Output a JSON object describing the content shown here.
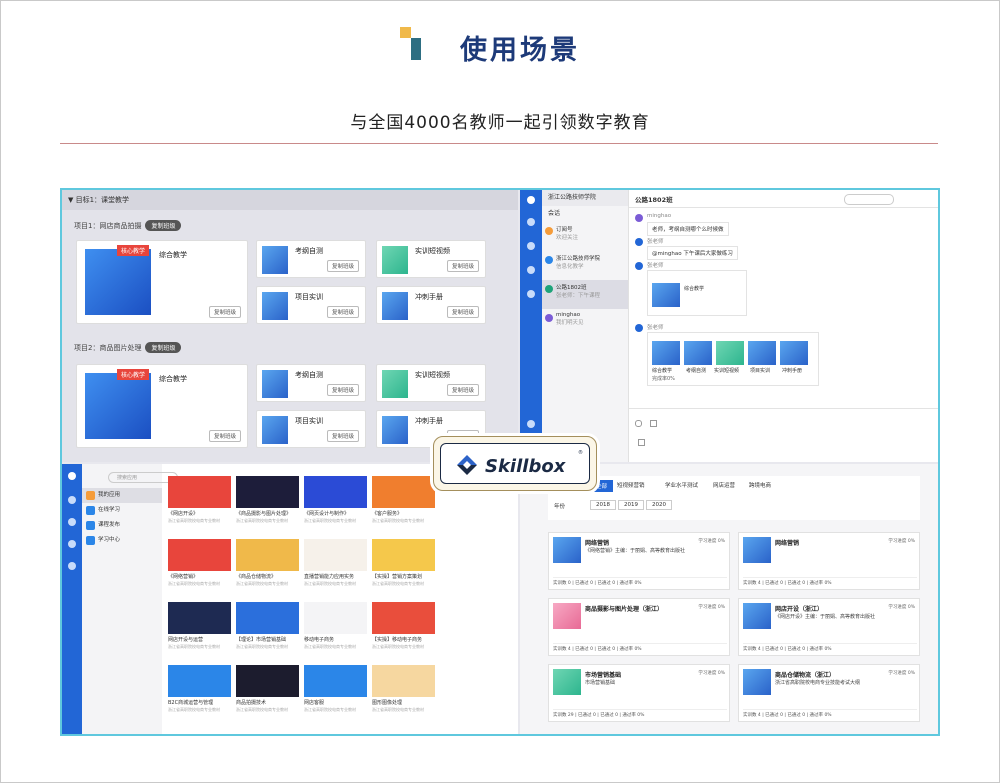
{
  "header": {
    "title": "使用场景",
    "subtitle": "与全国4000名教师一起引领数字教育"
  },
  "colors": {
    "brand_blue": "#2266d6",
    "title_navy": "#1d3a79",
    "frame_cyan": "#5fc8de",
    "accent_orange": "#f0b94a",
    "accent_teal": "#2d6e82"
  },
  "badge": {
    "label": "Skillbox",
    "reg": "®"
  },
  "q1": {
    "bar": "▼ 目标1：课堂教学",
    "project1": "项目1：网店商品拍摄",
    "project2": "项目2：商品图片处理",
    "copy_class": "复制班级",
    "ribbon": "核心教学",
    "cards": [
      "综合教学",
      "考纲自测",
      "实训短视频",
      "项目实训",
      "冲刺手册"
    ]
  },
  "q2": {
    "school": "浙江公路技师学院",
    "list_header": "会话",
    "list": [
      {
        "name": "订阅号",
        "preview": "欢迎关注"
      },
      {
        "name": "浙江公路技师学院",
        "preview": "信息化教学"
      },
      {
        "name": "公路1802班",
        "preview": "张老师：下午课程"
      },
      {
        "name": "minghao",
        "preview": "我们明天见"
      }
    ],
    "chat_title": "公路1802班",
    "m1_name": "minghao",
    "m1_text": "老师，考纲自测哪个么时候做",
    "m2_name": "张老师",
    "m2_text": "@minghao 下午课后大家做练习",
    "m3_name": "张老师",
    "m3_card": "综合教学",
    "m4_name": "张老师",
    "m4_items": [
      "综合教学",
      "考纲自测",
      "实训短视频",
      "项目实训",
      "冲刺手册"
    ],
    "m4_progress": "完成率0%"
  },
  "q3": {
    "search_placeholder": "搜索应用",
    "nav": [
      "我的应用",
      "在线学习",
      "课程发布",
      "学习中心"
    ],
    "tiles": [
      {
        "label": "《网店开设》",
        "sub": "浙江省高职院校电商专业教材"
      },
      {
        "label": "《商品摄影与图片处理》",
        "sub": "浙江省高职院校电商专业教材"
      },
      {
        "label": "《网页设计与制作》",
        "sub": "浙江省高职院校电商专业教材"
      },
      {
        "label": "《客户服务》",
        "sub": "浙江省高职院校电商专业教材"
      },
      {
        "label": "《网络营销》",
        "sub": "浙江省高职院校电商专业教材"
      },
      {
        "label": "《商品仓储物流》",
        "sub": "浙江省高职院校电商专业教材"
      },
      {
        "label": "直播营销能力应用实务",
        "sub": "浙江省高职院校电商专业教材"
      },
      {
        "label": "【实操】营销方案策划",
        "sub": "浙江省高职院校电商专业教材"
      },
      {
        "label": "网店开设与运营",
        "sub": "浙江省高职院校电商专业教材"
      },
      {
        "label": "【理论】市场营销基础",
        "sub": "浙江省高职院校电商专业教材"
      },
      {
        "label": "移动电子商务",
        "sub": "浙江省高职院校电商专业教材"
      },
      {
        "label": "【实操】移动电子商务",
        "sub": "浙江省高职院校电商专业教材"
      },
      {
        "label": "B2C商城运营与管理",
        "sub": "浙江省高职院校电商专业教材"
      },
      {
        "label": "商品拍摄技术",
        "sub": "浙江省高职院校电商专业教材"
      },
      {
        "label": "网店客服",
        "sub": "浙江省高职院校电商专业教材"
      },
      {
        "label": "图形图像处理",
        "sub": "浙江省高职院校电商专业教材"
      }
    ]
  },
  "q4": {
    "cat_label": "分类",
    "cats": [
      "全部",
      "短视频营销",
      "学业水平测试",
      "网店运营",
      "跨境电商"
    ],
    "year_label": "年份",
    "years": [
      "2018",
      "2019",
      "2020"
    ],
    "courses": [
      {
        "name": "网络营销",
        "desc": "《网络营销》主编：于丽娟、高等教育出版社",
        "rate": "学习进度 0%",
        "stats": "实训数 0 | 已通过 0 | 已通过 0 | 通过率 0%"
      },
      {
        "name": "网络营销",
        "desc": "",
        "rate": "学习进度 0%",
        "stats": "实训数 4 | 已通过 0 | 已通过 0 | 通过率 0%"
      },
      {
        "name": "商品摄影与图片处理（浙江）",
        "desc": "",
        "rate": "学习进度 0%",
        "stats": "实训数 4 | 已通过 0 | 已通过 0 | 通过率 0%"
      },
      {
        "name": "网店开设（浙江）",
        "desc": "《网店开设》主编：于丽娟、高等教育出版社",
        "rate": "学习进度 0%",
        "stats": "实训数 4 | 已通过 0 | 已通过 0 | 通过率 0%"
      },
      {
        "name": "市场营销基础",
        "desc": "市场营销基础",
        "rate": "学习进度 0%",
        "stats": "实训数 29 | 已通过 0 | 已通过 0 | 通过率 0%"
      },
      {
        "name": "商品仓储物流（浙江）",
        "desc": "浙江省高职院校电商专业技能考试大纲",
        "rate": "学习进度 0%",
        "stats": "实训数 4 | 已通过 0 | 已通过 0 | 通过率 0%"
      }
    ]
  }
}
